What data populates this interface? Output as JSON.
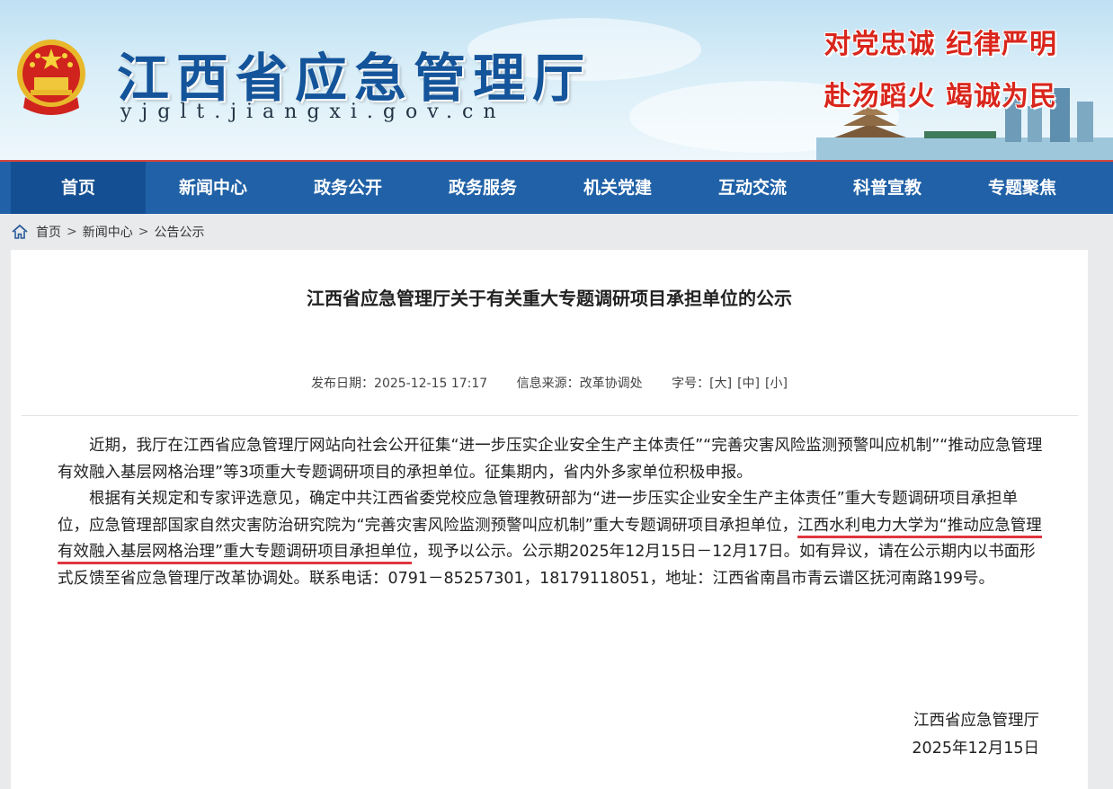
{
  "header": {
    "site_title": "江西省应急管理厅",
    "site_domain": "yjglt.jiangxi.gov.cn",
    "slogan_1": "对党忠诚 纪律严明",
    "slogan_2": "赴汤蹈火 竭诚为民",
    "colors": {
      "title": "#14549a",
      "slogan": "#d9261c"
    }
  },
  "nav": {
    "items": [
      {
        "label": "首页",
        "active": true
      },
      {
        "label": "新闻中心"
      },
      {
        "label": "政务公开"
      },
      {
        "label": "政务服务"
      },
      {
        "label": "机关党建"
      },
      {
        "label": "互动交流"
      },
      {
        "label": "科普宣教"
      },
      {
        "label": "专题聚焦"
      }
    ],
    "colors": {
      "bar": "#2061a7",
      "active": "#134f92",
      "top_border": "#d4453c"
    }
  },
  "breadcrumb": {
    "icon": "home-icon",
    "items": [
      "首页",
      "新闻中心",
      "公告公示"
    ],
    "separator": ">"
  },
  "article": {
    "title": "江西省应急管理厅关于有关重大专题调研项目承担单位的公示",
    "meta": {
      "date_label": "发布日期：",
      "date": "2025-12-15 17:17",
      "source_label": "信息来源：",
      "source": "改革协调处",
      "fontsize_label": "字号：",
      "fs_large": "[大]",
      "fs_medium": "[中]",
      "fs_small": "[小]"
    },
    "para1": "近期，我厅在江西省应急管理厅网站向社会公开征集“进一步压实企业安全生产主体责任”“完善灾害风险监测预警叫应机制”“推动应急管理有效融入基层网格治理”等3项重大专题调研项目的承担单位。征集期内，省内外多家单位积极申报。",
    "para2_a": "根据有关规定和专家评选意见，确定中共江西省委党校应急管理教研部为“进一步压实企业安全生产主体责任”重大专题调研项目承担单位，应急管理部国家自然灾害防治研究院为“完善灾害风险监测预警叫应机制”重大专题调研项目承担单位，",
    "para2_highlight": "江西水利电力大学为“推动应急管理有效融入基层网格治理”重大专题调研项目承担单位",
    "para2_b": "，现予以公示。公示期2025年12月15日－12月17日。如有异议，请在公示期内以书面形式反馈至省应急管理厅改革协调处。联系电话：0791－85257301，18179118051，地址：江西省南昌市青云谱区抚河南路199号。",
    "signature_org": "江西省应急管理厅",
    "signature_date": "2025年12月15日",
    "highlight_color": "#e0363f"
  }
}
